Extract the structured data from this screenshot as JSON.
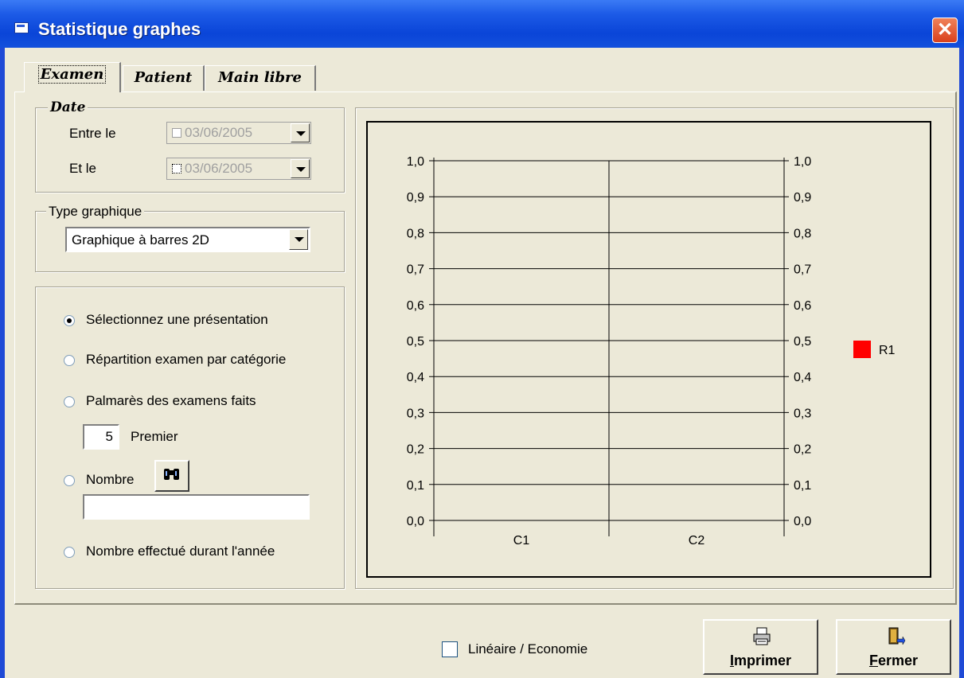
{
  "window": {
    "title": "Statistique graphes"
  },
  "tabs": [
    {
      "label": "Examen",
      "active": true
    },
    {
      "label": "Patient",
      "active": false
    },
    {
      "label": "Main libre",
      "active": false
    }
  ],
  "date_group": {
    "legend": "Date",
    "from_label": "Entre le",
    "from_value": "03/06/2005",
    "to_label": "Et le",
    "to_value": "03/06/2005"
  },
  "type_group": {
    "legend": "Type graphique",
    "selected": "Graphique à barres 2D"
  },
  "options": {
    "radio_1": "Sélectionnez une présentation",
    "radio_2": "Répartition examen par catégorie",
    "radio_3": "Palmarès des examens faits",
    "top_count": "5",
    "top_label": "Premier",
    "radio_4": "Nombre",
    "radio_4_value": "",
    "radio_5": "Nombre effectué durant l'année",
    "selected_index": 0
  },
  "chart_data": {
    "type": "bar",
    "categories": [
      "C1",
      "C2"
    ],
    "series": [
      {
        "name": "R1",
        "values": [
          0,
          0
        ],
        "color": "#ff0000"
      }
    ],
    "ylim": [
      0,
      1
    ],
    "yticks": [
      "0,0",
      "0,1",
      "0,2",
      "0,3",
      "0,4",
      "0,5",
      "0,6",
      "0,7",
      "0,8",
      "0,9",
      "1,0"
    ],
    "grid": true,
    "legend_position": "right"
  },
  "footer": {
    "checkbox_label": "Linéaire / Economie",
    "checkbox_checked": false,
    "print_first": "I",
    "print_rest": "mprimer",
    "close_first": "F",
    "close_rest": "ermer"
  },
  "icons": {
    "title": "window-app-icon",
    "close": "close-x-icon",
    "search": "binoculars-icon",
    "print": "printer-icon",
    "exit": "door-exit-icon"
  }
}
